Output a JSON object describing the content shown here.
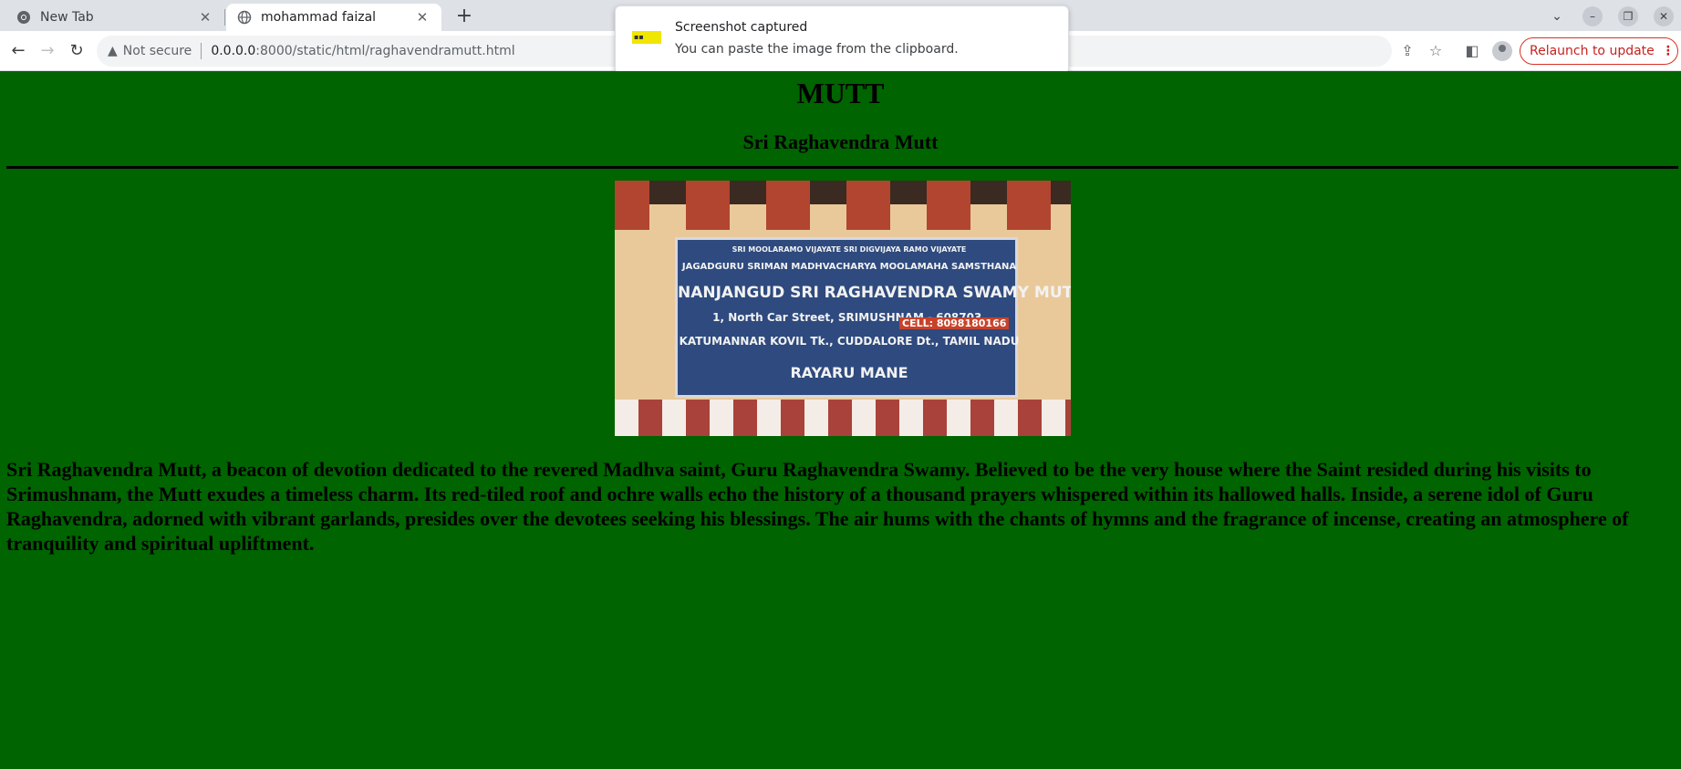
{
  "browser": {
    "tabs": [
      {
        "title": "New Tab",
        "icon": "chrome-icon",
        "active": false
      },
      {
        "title": "mohammad faizal",
        "icon": "globe-icon",
        "active": true
      }
    ],
    "security_label": "Not secure",
    "url_host": "0.0.0.0",
    "url_path": ":8000/static/html/raghavendramutt.html",
    "relaunch_label": "Relaunch to update"
  },
  "notification": {
    "title": "Screenshot captured",
    "message": "You can paste the image from the clipboard."
  },
  "page": {
    "heading": "MUTT",
    "subheading": "Sri Raghavendra Mutt",
    "image": {
      "sign_lines": [
        "SRI MOOLARAMO VIJAYATE          SRI DIGVIJAYA RAMO VIJAYATE",
        "JAGADGURU SRIMAN MADHVACHARYA MOOLAMAHA SAMSTHANA",
        "NANJANGUD SRI RAGHAVENDRA SWAMY MUTT",
        "1, North Car Street, SRIMUSHNAM - 608703.",
        "KATUMANNAR KOVIL Tk., CUDDALORE Dt., TAMIL NADU",
        "RAYARU MANE"
      ],
      "cell_label": "CELL: 8098180166"
    },
    "paragraph": "Sri Raghavendra Mutt, a beacon of devotion dedicated to the revered Madhva saint, Guru Raghavendra Swamy. Believed to be the very house where the Saint resided during his visits to Srimushnam, the Mutt exudes a timeless charm. Its red-tiled roof and ochre walls echo the history of a thousand prayers whispered within its hallowed halls. Inside, a serene idol of Guru Raghavendra, adorned with vibrant garlands, presides over the devotees seeking his blessings. The air hums with the chants of hymns and the fragrance of incense, creating an atmosphere of tranquility and spiritual upliftment."
  },
  "colors": {
    "page_background": "#006400",
    "relaunch_accent": "#c5221f"
  }
}
